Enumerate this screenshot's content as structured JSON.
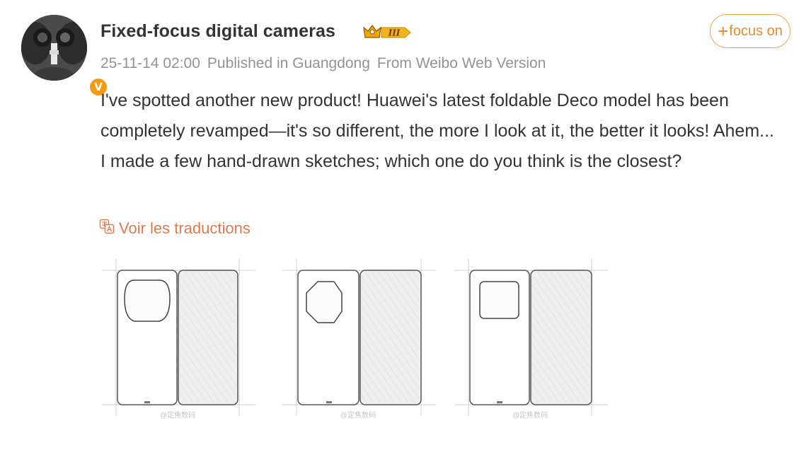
{
  "user": {
    "name": "Fixed-focus digital cameras",
    "level_badge": "III",
    "verified_mark": "V"
  },
  "meta": {
    "timestamp": "25-11-14 02:00",
    "location": "Published in Guangdong",
    "source": "From Weibo Web Version"
  },
  "follow_button": {
    "plus": "+",
    "label": "focus on"
  },
  "post": {
    "text": "I've spotted another new product! Huawei's latest foldable Deco model has been completely revamped—it's so different, the more I look at it, the better it looks! Ahem... I made a few hand-drawn sketches; which one do you think is the closest?",
    "translate_label": "Voir les traductions"
  },
  "images": [
    {
      "camera_shape": "rounded-circle",
      "watermark": "@定焦数码"
    },
    {
      "camera_shape": "hexagon",
      "watermark": "@定焦数码"
    },
    {
      "camera_shape": "rounded-square",
      "watermark": "@定焦数码"
    }
  ],
  "colors": {
    "accent": "#e98b2a",
    "link": "#e07a4a",
    "meta_text": "#939393",
    "badge": "#f39c12"
  }
}
